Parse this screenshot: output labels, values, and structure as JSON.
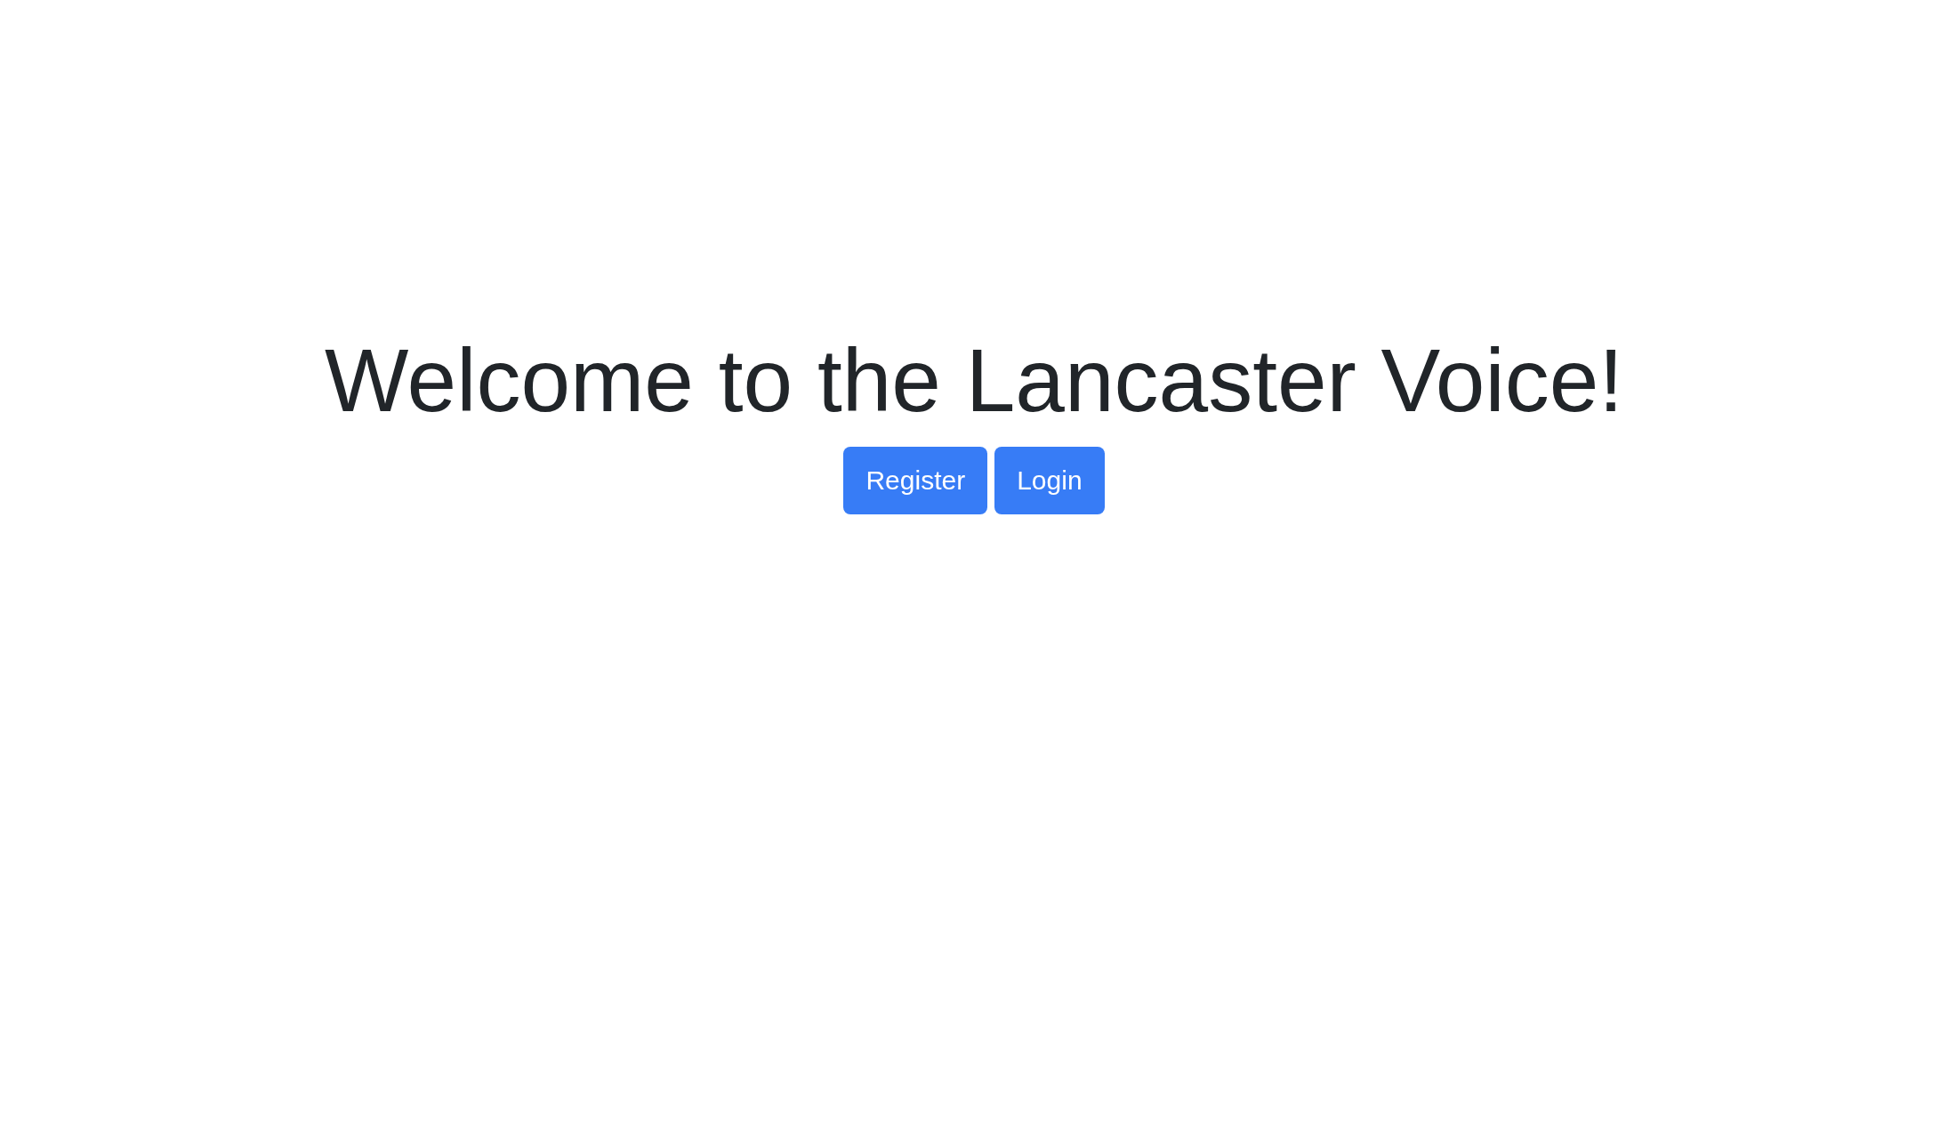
{
  "heading": "Welcome to the Lancaster Voice!",
  "buttons": [
    {
      "label": "Register"
    },
    {
      "label": "Login"
    }
  ]
}
